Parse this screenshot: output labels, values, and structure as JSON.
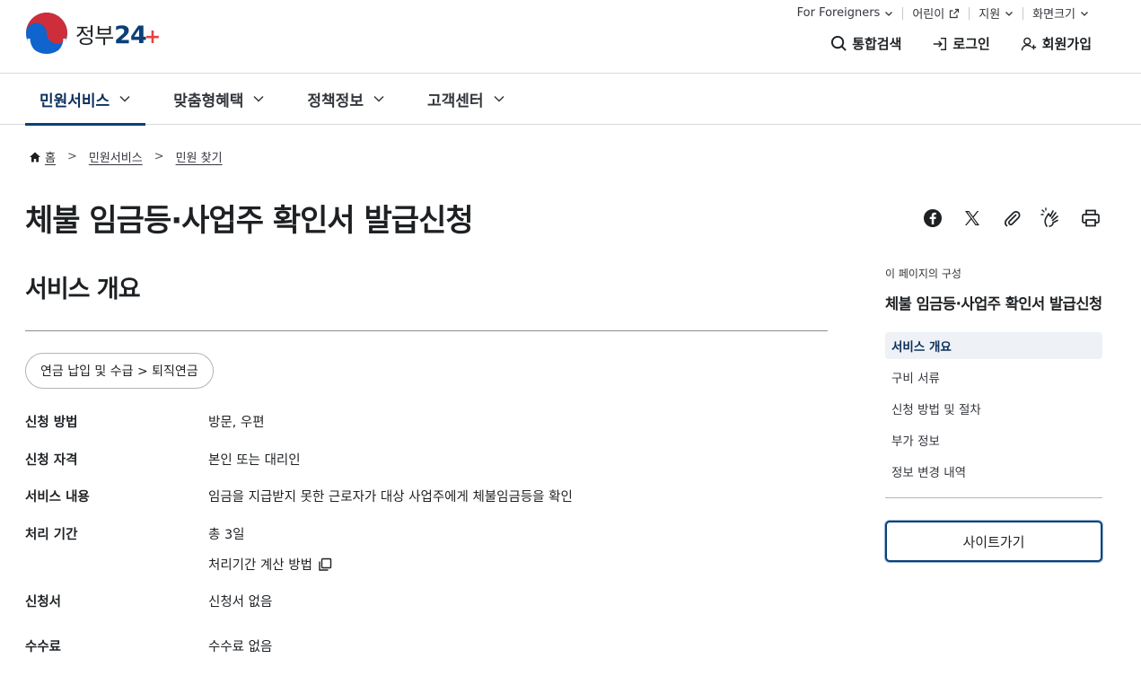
{
  "logo": {
    "text": "정부",
    "number": "24",
    "plus": "+"
  },
  "utility_nav": [
    {
      "label": "For Foreigners",
      "icon": "chevron-down-icon"
    },
    {
      "label": "어린이",
      "icon": "external-link-icon"
    },
    {
      "label": "지원",
      "icon": "chevron-down-icon"
    },
    {
      "label": "화면크기",
      "icon": "chevron-down-icon"
    }
  ],
  "actions": {
    "search": "통합검색",
    "login": "로그인",
    "signup": "회원가입"
  },
  "gnb": [
    {
      "label": "민원서비스",
      "active": true
    },
    {
      "label": "맞춤형혜택",
      "active": false
    },
    {
      "label": "정책정보",
      "active": false
    },
    {
      "label": "고객센터",
      "active": false
    }
  ],
  "breadcrumb": [
    "홈",
    "민원서비스",
    "민원 찾기"
  ],
  "page": {
    "title": "체불 임금등·사업주 확인서 발급신청"
  },
  "share_icons": [
    "facebook-icon",
    "x-icon",
    "link-icon",
    "sign-language-icon",
    "print-icon"
  ],
  "overview": {
    "title": "서비스 개요",
    "category": "연금 납입 및 수급 > 퇴직연금",
    "rows": [
      {
        "label": "신청 방법",
        "value": "방문, 우편"
      },
      {
        "label": "신청 자격",
        "value": "본인 또는 대리인"
      },
      {
        "label": "서비스 내용",
        "value": "임금을 지급받지 못한 근로자가 대상 사업주에게 체불임금등을 확인"
      },
      {
        "label": "처리 기간",
        "value": "총 3일",
        "link": "처리기간 계산 방법"
      },
      {
        "label": "신청서",
        "value": "신청서 없음"
      },
      {
        "label": "수수료",
        "value": "수수료 없음"
      }
    ]
  },
  "aside": {
    "caption": "이 페이지의 구성",
    "title": "체불 임금등·사업주 확인서 발급신청",
    "toc": [
      {
        "label": "서비스 개요",
        "active": true
      },
      {
        "label": "구비 서류",
        "active": false
      },
      {
        "label": "신청 방법 및 절차",
        "active": false
      },
      {
        "label": "부가 정보",
        "active": false
      },
      {
        "label": "정보 변경 내역",
        "active": false
      }
    ],
    "site_button": "사이트가기"
  },
  "colors": {
    "primary": "#0b4077",
    "logo_red": "#cd2e3a",
    "logo_blue": "#0f64cd",
    "text": "#1e2124",
    "active_bg": "#eef1f5"
  }
}
